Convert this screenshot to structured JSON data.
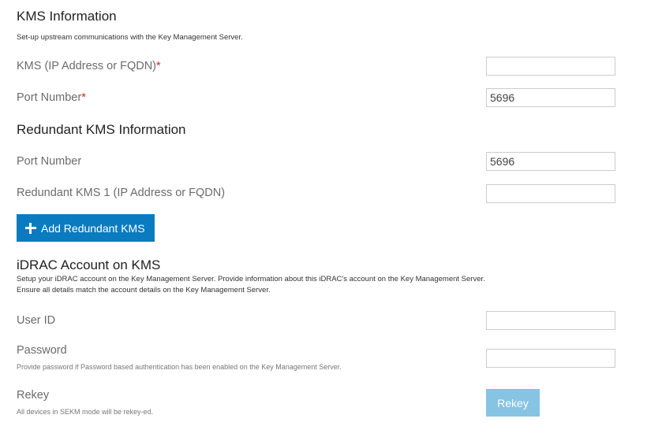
{
  "kms": {
    "title": "KMS Information",
    "description": "Set-up upstream communications with the Key Management Server.",
    "address_label": "KMS (IP Address or FQDN)",
    "address_value": "",
    "port_label": "Port Number",
    "port_value": "5696",
    "required_mark": "*"
  },
  "redundant": {
    "title": "Redundant KMS Information",
    "port_label": "Port Number",
    "port_value": "5696",
    "kms1_label": "Redundant KMS 1 (IP Address or FQDN)",
    "kms1_value": "",
    "add_button_label": "Add Redundant KMS",
    "add_button_icon": "plus-icon"
  },
  "account": {
    "title": "iDRAC Account on KMS",
    "description_line1": "Setup your iDRAC account on the Key Management Server. Provide information about this iDRAC's account on the Key Management Server.",
    "description_line2": "Ensure all details match the account details on the Key Management Server.",
    "user_id_label": "User ID",
    "user_id_value": "",
    "password_label": "Password",
    "password_help": "Provide password if Password based authentication has been enabled on the Key Management Server.",
    "password_value": ""
  },
  "rekey": {
    "label": "Rekey",
    "help": "All devices in SEKM mode will be rekey-ed.",
    "button_label": "Rekey",
    "button_enabled": false
  },
  "colors": {
    "primary_button": "#0a7bbf",
    "disabled_button": "#87c3e3",
    "required_mark": "#e02020"
  }
}
